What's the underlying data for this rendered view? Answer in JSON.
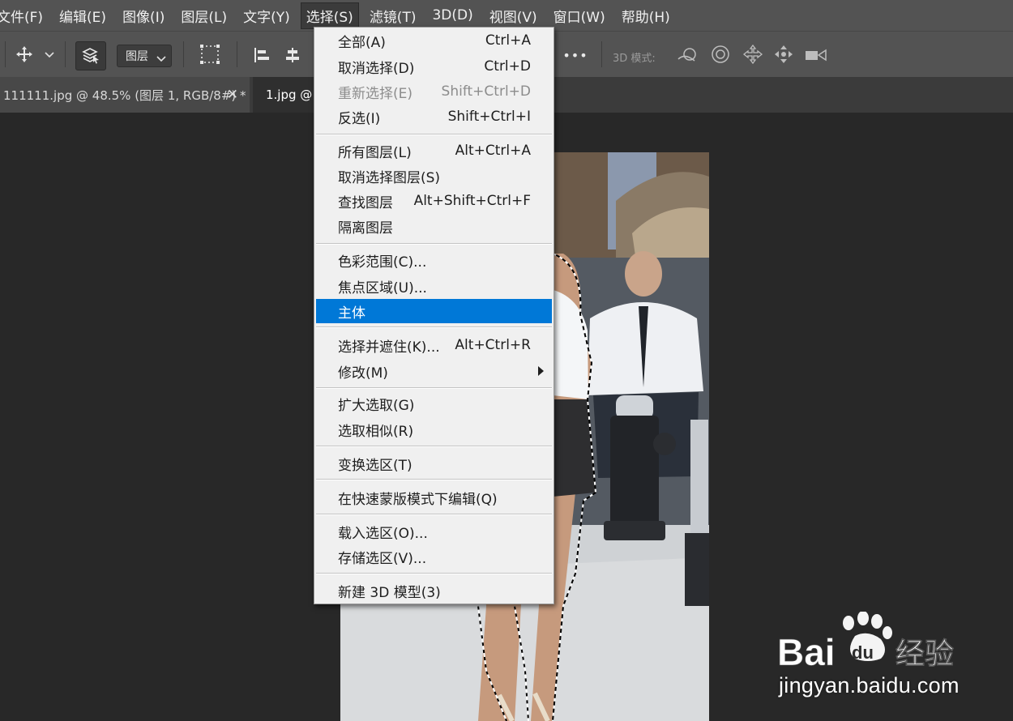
{
  "menubar": {
    "items": [
      "文件(F)",
      "编辑(E)",
      "图像(I)",
      "图层(L)",
      "文字(Y)",
      "选择(S)",
      "滤镜(T)",
      "3D(D)",
      "视图(V)",
      "窗口(W)",
      "帮助(H)"
    ],
    "active_index": 5
  },
  "toolbar": {
    "layer_dropdown": "图层",
    "mode_3d_label": "3D 模式:",
    "more_label": "•••"
  },
  "tabs": [
    {
      "title": "111111.jpg @ 48.5% (图层 1, RGB/8#) *",
      "close": "✕"
    },
    {
      "title": "1.jpg @ 3"
    }
  ],
  "select_menu": {
    "items": [
      {
        "label": "全部(A)",
        "shortcut": "Ctrl+A"
      },
      {
        "label": "取消选择(D)",
        "shortcut": "Ctrl+D"
      },
      {
        "label": "重新选择(E)",
        "shortcut": "Shift+Ctrl+D",
        "disabled": true
      },
      {
        "label": "反选(I)",
        "shortcut": "Shift+Ctrl+I"
      },
      {
        "label": "所有图层(L)",
        "shortcut": "Alt+Ctrl+A"
      },
      {
        "label": "取消选择图层(S)",
        "shortcut": ""
      },
      {
        "label": "查找图层",
        "shortcut": "Alt+Shift+Ctrl+F"
      },
      {
        "label": "隔离图层",
        "shortcut": ""
      },
      {
        "label": "色彩范围(C)...",
        "shortcut": ""
      },
      {
        "label": "焦点区域(U)...",
        "shortcut": ""
      },
      {
        "label": "主体",
        "shortcut": "",
        "highlighted": true
      },
      {
        "label": "选择并遮住(K)...",
        "shortcut": "Alt+Ctrl+R"
      },
      {
        "label": "修改(M)",
        "shortcut": "",
        "submenu": true
      },
      {
        "label": "扩大选取(G)",
        "shortcut": ""
      },
      {
        "label": "选取相似(R)",
        "shortcut": ""
      },
      {
        "label": "变换选区(T)",
        "shortcut": ""
      },
      {
        "label": "在快速蒙版模式下编辑(Q)",
        "shortcut": ""
      },
      {
        "label": "载入选区(O)...",
        "shortcut": ""
      },
      {
        "label": "存储选区(V)...",
        "shortcut": ""
      },
      {
        "label": "新建 3D 模型(3)",
        "shortcut": ""
      }
    ]
  },
  "watermark": {
    "brand": "Bai du 经验",
    "url": "jingyan.baidu.com"
  },
  "colors": {
    "menubar": "#535353",
    "canvas_bg": "#282828",
    "menu_bg": "#f0f0f0",
    "highlight": "#0078d7"
  }
}
